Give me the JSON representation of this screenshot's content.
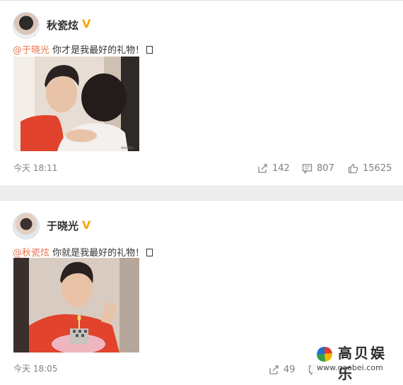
{
  "posts": [
    {
      "author": "秋瓷炫",
      "mention": "@于晓光",
      "text": " 你才是我最好的礼物！",
      "time": "今天 18:11",
      "reposts": "142",
      "comments": "807",
      "likes": "15625",
      "avatar_icon": "profile-photo-woman",
      "photo_desc_icon": "couple-photo"
    },
    {
      "author": "于晓光",
      "mention": "@秋瓷炫",
      "text": " 你就是我最好的礼物！",
      "time": "今天 18:05",
      "reposts": "49",
      "comments": "",
      "avatar_icon": "profile-photo-man",
      "photo_desc_icon": "birthday-cake-photo"
    }
  ],
  "watermark": {
    "name": "高贝娱乐",
    "url": "www.gaobei.com"
  },
  "colors": {
    "mention": "#eb7350",
    "verified": "#f2a900",
    "meta_text": "#808080",
    "background": "#ededed"
  }
}
